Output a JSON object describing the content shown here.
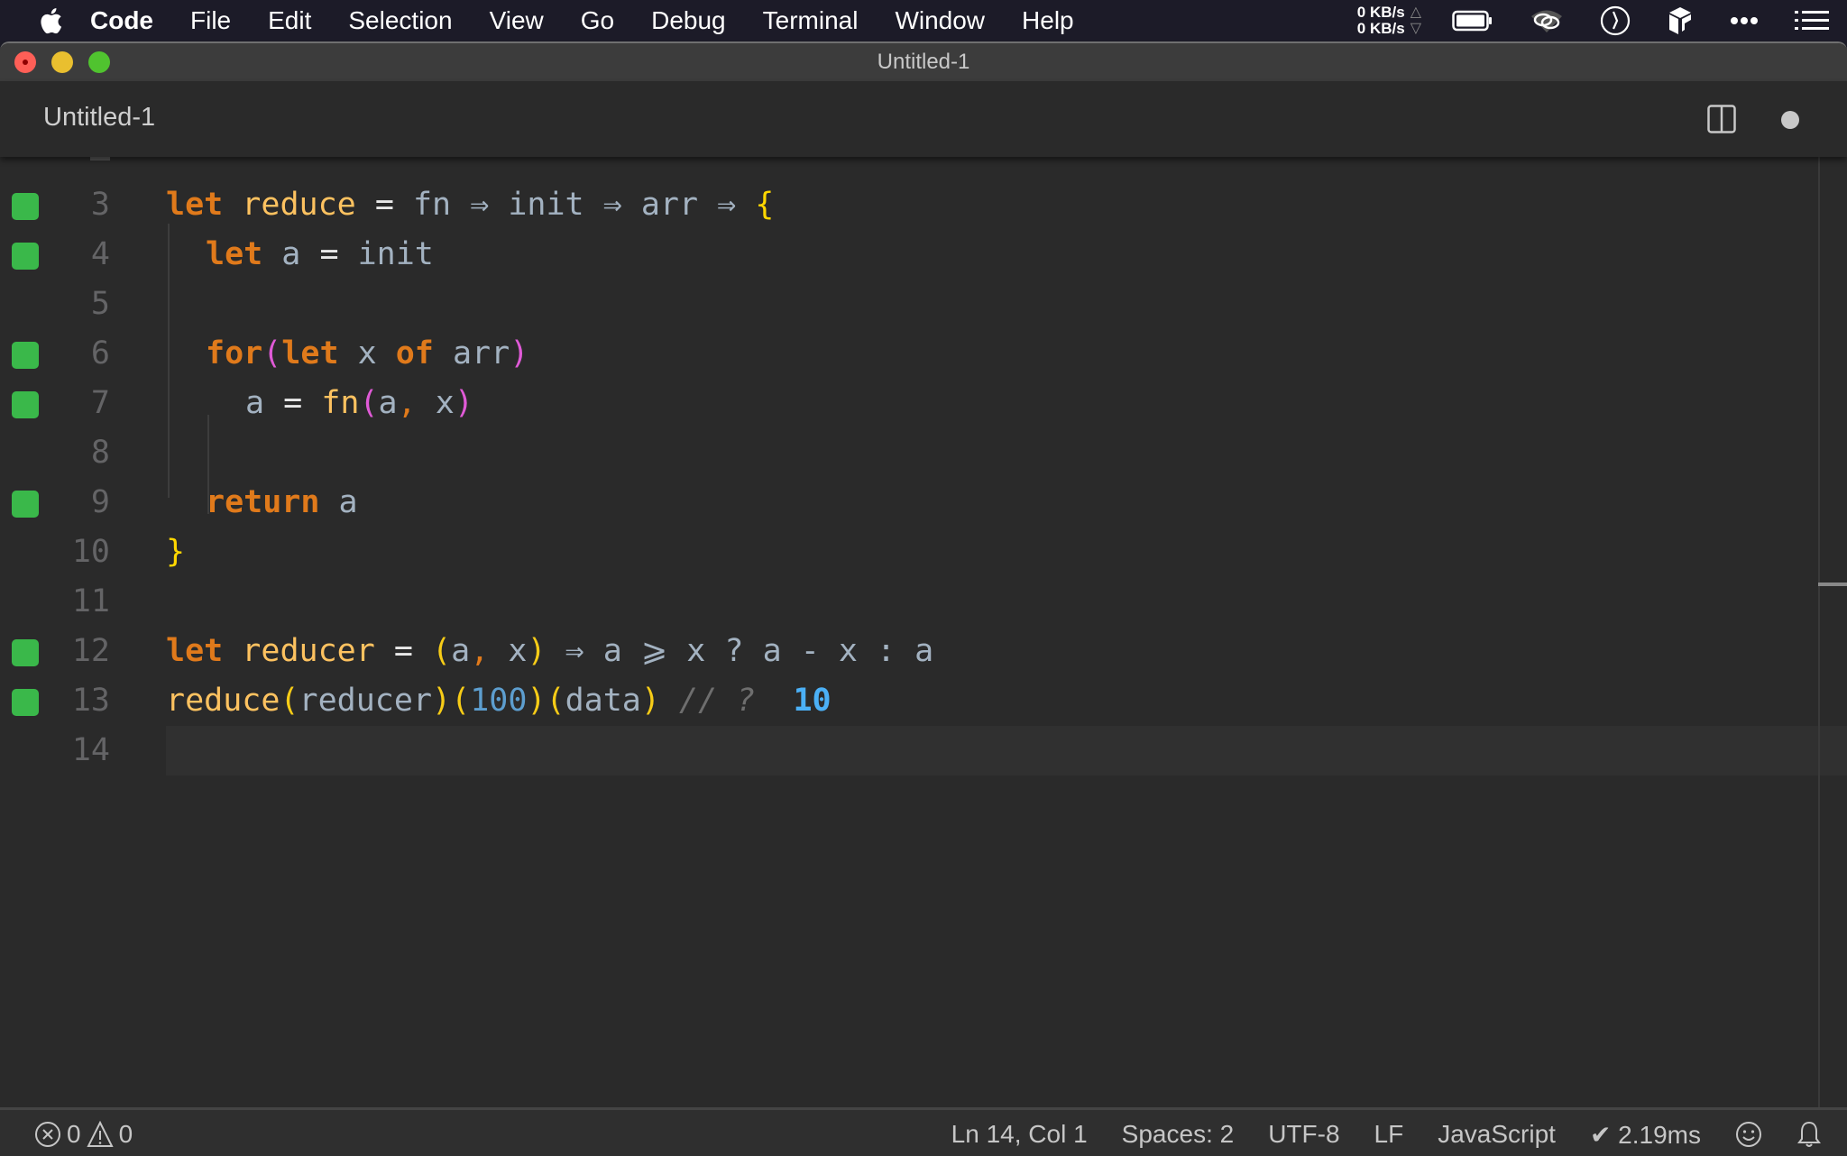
{
  "menubar": {
    "apple_icon": "apple-logo",
    "items": [
      "Code",
      "File",
      "Edit",
      "Selection",
      "View",
      "Go",
      "Debug",
      "Terminal",
      "Window",
      "Help"
    ],
    "net_up": "0 KB/s",
    "net_down": "0 KB/s",
    "net_up_arrow": "△",
    "net_down_arrow": "▽",
    "tray_icons": [
      "battery-icon",
      "wifi-link-icon",
      "clock-icon",
      "box-icon",
      "more-dots-icon",
      "list-icon"
    ]
  },
  "window": {
    "title": "Untitled-1"
  },
  "tab": {
    "title": "Untitled-1",
    "split_icon": "split-editor-icon",
    "dirty_indicator": "unsaved-dot"
  },
  "editor": {
    "lines": [
      {
        "num": "3",
        "marked": true,
        "text": "let reduce = fn ⇒ init ⇒ arr ⇒ {"
      },
      {
        "num": "4",
        "marked": true,
        "text": "  let a = init"
      },
      {
        "num": "5",
        "marked": false,
        "text": ""
      },
      {
        "num": "6",
        "marked": true,
        "text": "  for(let x of arr)"
      },
      {
        "num": "7",
        "marked": true,
        "text": "    a = fn(a, x)"
      },
      {
        "num": "8",
        "marked": false,
        "text": ""
      },
      {
        "num": "9",
        "marked": true,
        "text": "  return a"
      },
      {
        "num": "10",
        "marked": false,
        "text": "}"
      },
      {
        "num": "11",
        "marked": false,
        "text": ""
      },
      {
        "num": "12",
        "marked": true,
        "text": "let reducer = (a, x) ⇒ a ⩾ x ? a - x : a"
      },
      {
        "num": "13",
        "marked": true,
        "text": "reduce(reducer)(100)(data) // ?  10"
      },
      {
        "num": "14",
        "marked": false,
        "text": ""
      }
    ],
    "tokens": {
      "l3": [
        "let",
        " ",
        "reduce",
        " ",
        "=",
        " fn ",
        "⇒",
        " init ",
        "⇒",
        " arr ",
        "⇒",
        " ",
        "{"
      ],
      "l4": [
        "let",
        " a ",
        "=",
        " init"
      ],
      "l6": [
        "for",
        "(",
        "let",
        " x ",
        "of",
        " arr",
        ")"
      ],
      "l7": [
        "a ",
        "=",
        " ",
        "fn",
        "(",
        "a",
        ",",
        " x",
        ")"
      ],
      "l9": [
        "return",
        " a"
      ],
      "l10": [
        "}"
      ],
      "l12": [
        "let",
        " ",
        "reducer",
        " ",
        "=",
        " ",
        "(",
        "a",
        ",",
        " x",
        ")",
        " ",
        "⇒",
        " a ",
        "⩾",
        " x ? a - x : a"
      ],
      "l13": [
        "reduce",
        "(",
        "reducer",
        ")",
        "(",
        "100",
        ")",
        "(",
        "data",
        ")",
        " ",
        "// ?",
        "  ",
        "10"
      ]
    },
    "current_line": "14"
  },
  "statusbar": {
    "errors": "0",
    "warnings": "0",
    "position": "Ln 14, Col 1",
    "indent": "Spaces: 2",
    "encoding": "UTF-8",
    "eol": "LF",
    "language": "JavaScript",
    "timing": "✔ 2.19ms",
    "feedback_icon": "smiley-icon",
    "notifications_icon": "bell-icon"
  },
  "colors": {
    "gutter_marker": "#3ab84a",
    "keyword": "#e07a1b",
    "function": "#fdc260",
    "identifier": "#a3b2c1",
    "number": "#5d9ecf",
    "result": "#4bb0f6"
  }
}
